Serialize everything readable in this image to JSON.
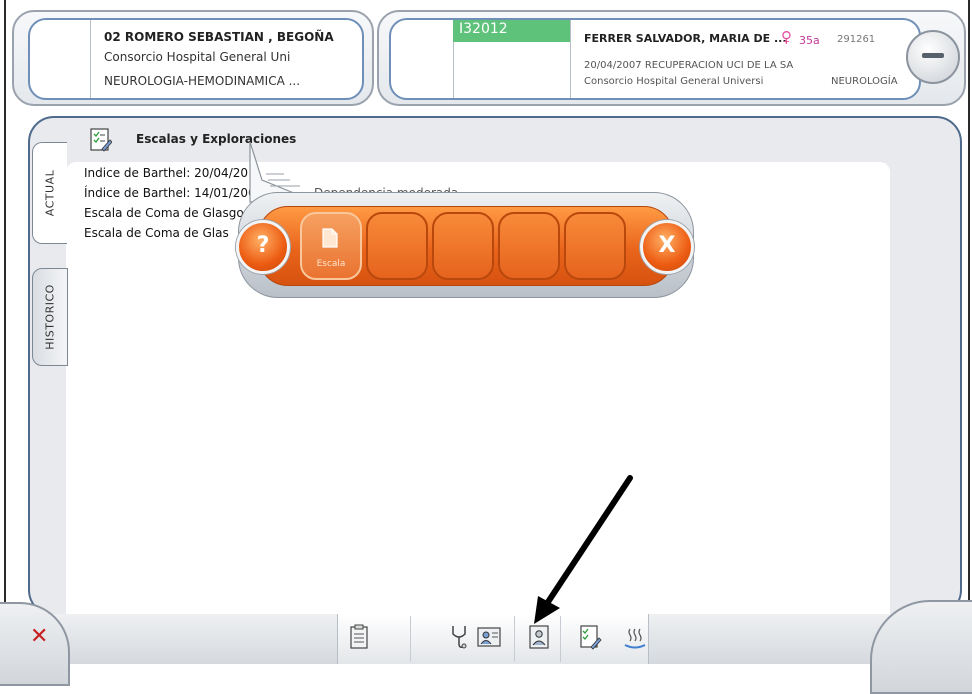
{
  "patient_box": {
    "line1": "02 ROMERO SEBASTIAN , BEGOÑA",
    "line2": "Consorcio Hospital General Uni",
    "line3": "NEUROLOGIA-HEMODINAMICA ..."
  },
  "episode_box": {
    "episode_id": "I32012",
    "name": "FERRER SALVADOR, MARIA DE ...",
    "age": "35a",
    "number": "291261",
    "detail": "20/04/2007  RECUPERACION UCI DE LA SA",
    "hospital": "Consorcio Hospital General Universi",
    "service": "NEUROLOGÍA"
  },
  "tabs": [
    {
      "label": "ACTUAL"
    },
    {
      "label": "HISTORICO"
    }
  ],
  "section": {
    "title": "Escalas y Exploraciones"
  },
  "items": [
    {
      "text": "Indice de Barthel: 20/04/20",
      "rest": ""
    },
    {
      "text": "Índice de Barthel: 14/01/200",
      "rest": "Dependencia moderada"
    },
    {
      "text": "Escala de Coma de Glasgo",
      "rest": ""
    },
    {
      "text": "Escala de Coma de Glas",
      "rest": ""
    }
  ],
  "popup": {
    "help_label": "?",
    "close_label": "X",
    "slot_label": "Escala"
  },
  "colors": {
    "accent_orange": "#e9641b",
    "frame_blue": "#4f6a8c",
    "episode_green": "#5fc27a"
  },
  "toolbar": {
    "icons": [
      "report-icon",
      "stethoscope-icon",
      "patient-chart-icon",
      "doctor-record-icon",
      "checklist-edit-icon",
      "heat-icon"
    ]
  }
}
